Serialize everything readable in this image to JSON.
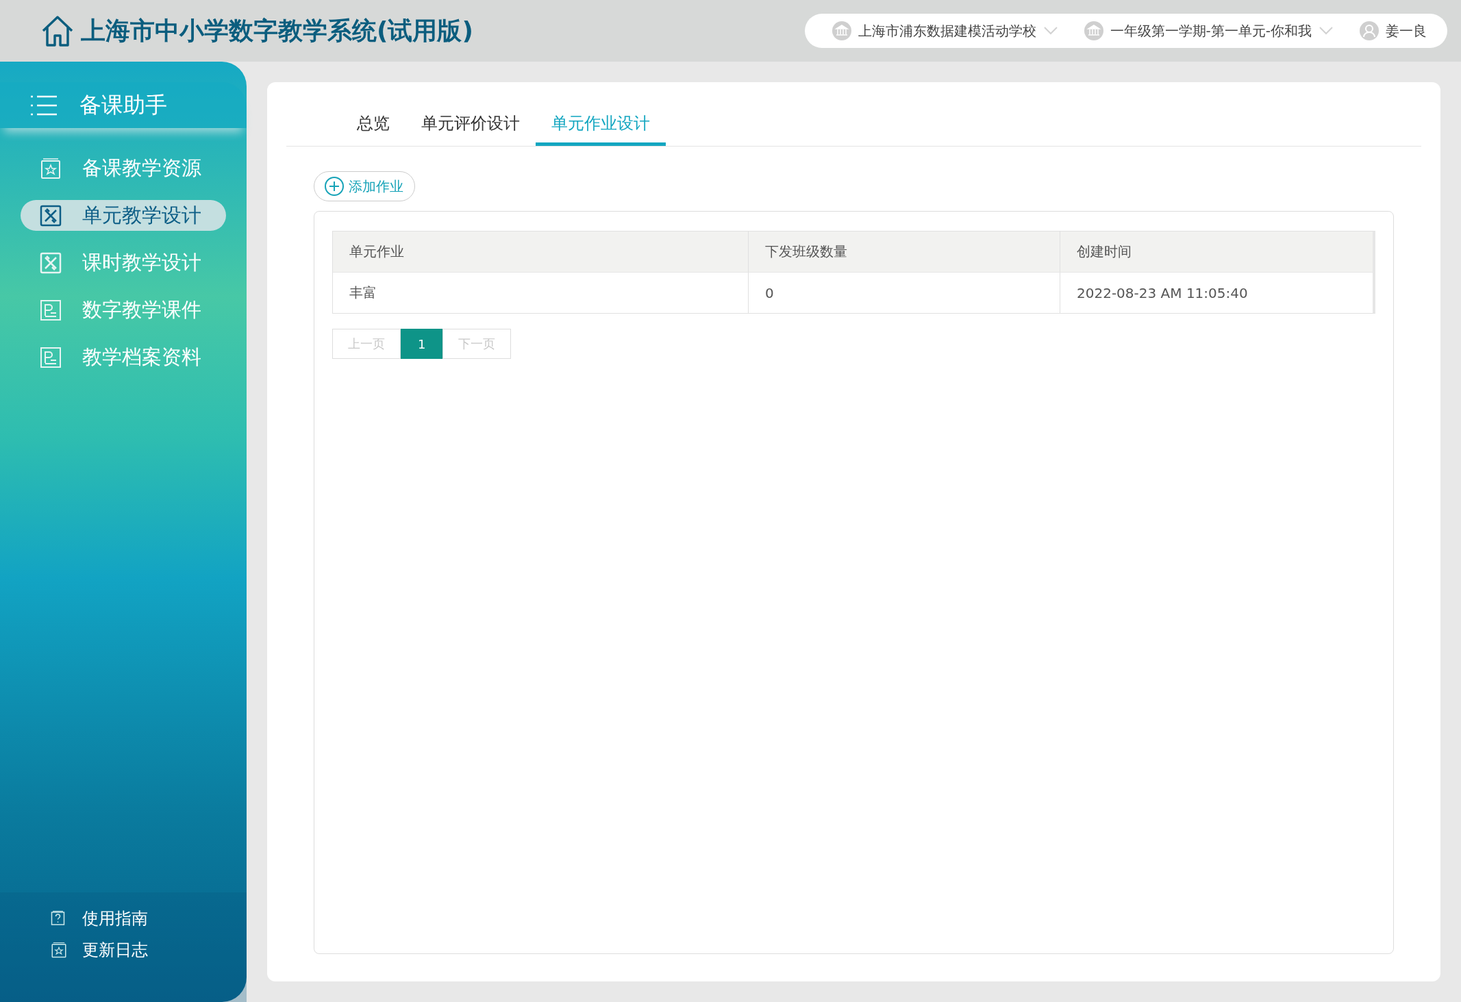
{
  "header": {
    "title": "上海市中小学数字教学系统(试用版)",
    "selectors": [
      {
        "kind": "school",
        "label": "上海市浦东数据建模活动学校"
      },
      {
        "kind": "term",
        "label": "一年级第一学期-第一单元-你和我"
      },
      {
        "kind": "user",
        "label": "姜一良"
      }
    ]
  },
  "sidebar": {
    "title": "备课助手",
    "items": [
      {
        "label": "备课教学资源",
        "selected": false
      },
      {
        "label": "单元教学设计",
        "selected": true
      },
      {
        "label": "课时教学设计",
        "selected": false
      },
      {
        "label": "数字教学课件",
        "selected": false
      },
      {
        "label": "教学档案资料",
        "selected": false
      }
    ],
    "footer_links": [
      {
        "label": "使用指南"
      },
      {
        "label": "更新日志"
      }
    ]
  },
  "tabs": [
    {
      "label": "总览",
      "selected": false
    },
    {
      "label": "单元评价设计",
      "selected": false
    },
    {
      "label": "单元作业设计",
      "selected": true
    }
  ],
  "add_button": "添加作业",
  "table": {
    "columns": [
      "单元作业",
      "下发班级数量",
      "创建时间"
    ],
    "rows": [
      [
        "丰富",
        "0",
        "2022-08-23 AM 11:05:40"
      ]
    ]
  },
  "pagination": {
    "prev": {
      "label": "上一页",
      "disabled": true
    },
    "pages": [
      {
        "label": "1",
        "selected": true
      }
    ],
    "next": {
      "label": "下一页",
      "disabled": true
    }
  }
}
